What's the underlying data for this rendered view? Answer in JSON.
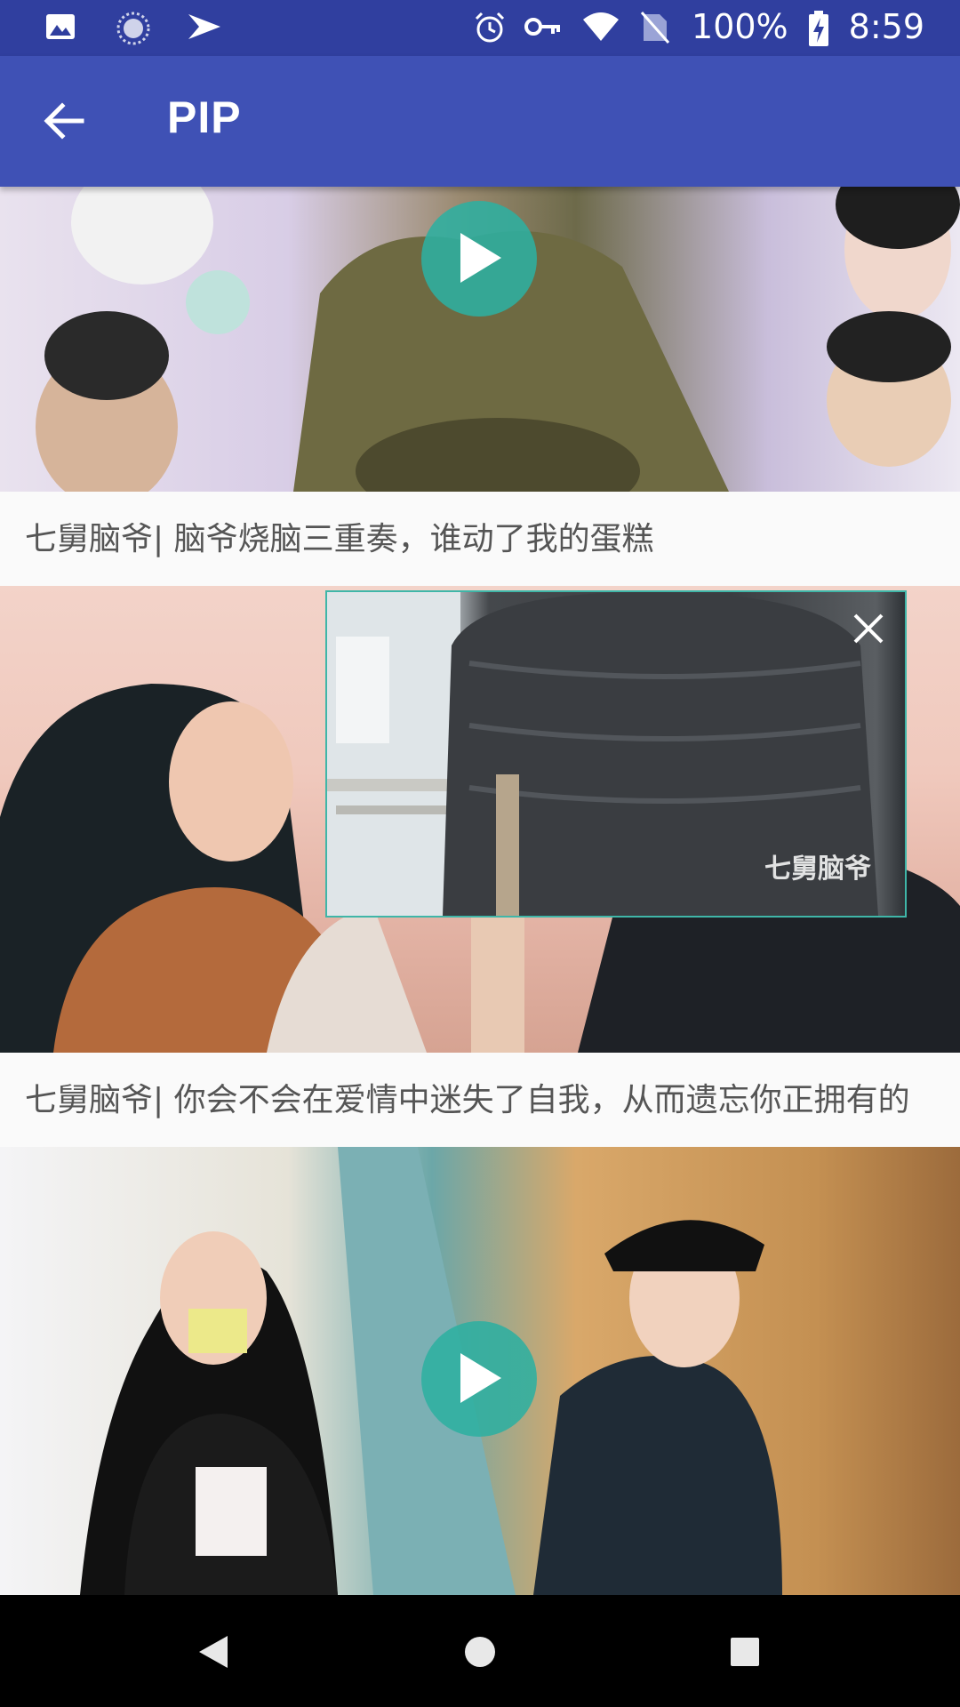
{
  "status_bar": {
    "left_icons": [
      "image-icon",
      "sync-icon",
      "send-icon"
    ],
    "right_icons": [
      "alarm-icon",
      "vpn-key-icon",
      "wifi-icon",
      "no-sim-icon",
      "battery-charging-icon"
    ],
    "battery": "100%",
    "time": "8:59"
  },
  "app_bar": {
    "title": "PIP",
    "back_icon": "arrow-back-icon"
  },
  "feed": [
    {
      "caption": "七舅脑爷| 脑爷烧脑三重奏，谁动了我的蛋糕"
    },
    {
      "caption": "七舅脑爷| 你会不会在爱情中迷失了自我，从而遗忘你正拥有的"
    }
  ],
  "pip": {
    "watermark": "七舅脑爷",
    "close_icon": "close-icon"
  },
  "nav_bar": {
    "buttons": [
      "back-triangle-icon",
      "home-circle-icon",
      "recents-square-icon"
    ]
  },
  "colors": {
    "status_bar": "#303f9f",
    "app_bar": "#3f51b5",
    "play_button": "#2eafa0",
    "pip_border": "#3fb6a8"
  }
}
